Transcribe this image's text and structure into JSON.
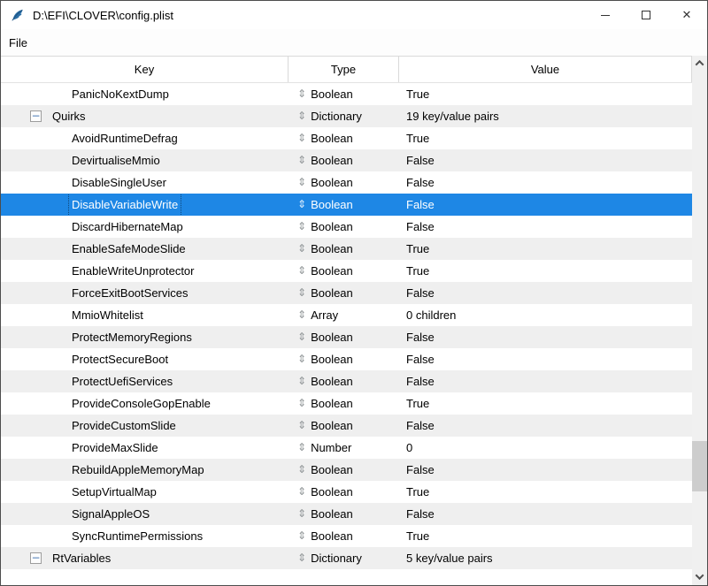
{
  "window": {
    "title": "D:\\EFI\\CLOVER\\config.plist"
  },
  "menu": {
    "items": [
      {
        "label": "File"
      }
    ]
  },
  "icons": {
    "app_icon": "python-feather-icon",
    "updown_glyph": "⇕",
    "collapse_glyph": "−",
    "close_glyph": "✕",
    "minimize_glyph": "–",
    "maximize_glyph": "□",
    "scroll_up": "chevron-up",
    "scroll_down": "chevron-down"
  },
  "colors": {
    "selection": "#1e87e5",
    "stripe": "#efefef",
    "scroll_track": "#f0f0f0",
    "scroll_thumb": "#cdcdcd"
  },
  "table": {
    "columns": [
      "Key",
      "Type",
      "Value"
    ],
    "rows": [
      {
        "key": "PanicNoKextDump",
        "type": "Boolean",
        "value": "True",
        "level": 2,
        "has_children": false,
        "selected": false
      },
      {
        "key": "Quirks",
        "type": "Dictionary",
        "value": "19 key/value pairs",
        "level": 1,
        "has_children": true,
        "selected": false
      },
      {
        "key": "AvoidRuntimeDefrag",
        "type": "Boolean",
        "value": "True",
        "level": 2,
        "has_children": false,
        "selected": false
      },
      {
        "key": "DevirtualiseMmio",
        "type": "Boolean",
        "value": "False",
        "level": 2,
        "has_children": false,
        "selected": false
      },
      {
        "key": "DisableSingleUser",
        "type": "Boolean",
        "value": "False",
        "level": 2,
        "has_children": false,
        "selected": false
      },
      {
        "key": "DisableVariableWrite",
        "type": "Boolean",
        "value": "False",
        "level": 2,
        "has_children": false,
        "selected": true
      },
      {
        "key": "DiscardHibernateMap",
        "type": "Boolean",
        "value": "False",
        "level": 2,
        "has_children": false,
        "selected": false
      },
      {
        "key": "EnableSafeModeSlide",
        "type": "Boolean",
        "value": "True",
        "level": 2,
        "has_children": false,
        "selected": false
      },
      {
        "key": "EnableWriteUnprotector",
        "type": "Boolean",
        "value": "True",
        "level": 2,
        "has_children": false,
        "selected": false
      },
      {
        "key": "ForceExitBootServices",
        "type": "Boolean",
        "value": "False",
        "level": 2,
        "has_children": false,
        "selected": false
      },
      {
        "key": "MmioWhitelist",
        "type": "Array",
        "value": "0 children",
        "level": 2,
        "has_children": false,
        "selected": false
      },
      {
        "key": "ProtectMemoryRegions",
        "type": "Boolean",
        "value": "False",
        "level": 2,
        "has_children": false,
        "selected": false
      },
      {
        "key": "ProtectSecureBoot",
        "type": "Boolean",
        "value": "False",
        "level": 2,
        "has_children": false,
        "selected": false
      },
      {
        "key": "ProtectUefiServices",
        "type": "Boolean",
        "value": "False",
        "level": 2,
        "has_children": false,
        "selected": false
      },
      {
        "key": "ProvideConsoleGopEnable",
        "type": "Boolean",
        "value": "True",
        "level": 2,
        "has_children": false,
        "selected": false
      },
      {
        "key": "ProvideCustomSlide",
        "type": "Boolean",
        "value": "False",
        "level": 2,
        "has_children": false,
        "selected": false
      },
      {
        "key": "ProvideMaxSlide",
        "type": "Number",
        "value": "0",
        "level": 2,
        "has_children": false,
        "selected": false
      },
      {
        "key": "RebuildAppleMemoryMap",
        "type": "Boolean",
        "value": "False",
        "level": 2,
        "has_children": false,
        "selected": false
      },
      {
        "key": "SetupVirtualMap",
        "type": "Boolean",
        "value": "True",
        "level": 2,
        "has_children": false,
        "selected": false
      },
      {
        "key": "SignalAppleOS",
        "type": "Boolean",
        "value": "False",
        "level": 2,
        "has_children": false,
        "selected": false
      },
      {
        "key": "SyncRuntimePermissions",
        "type": "Boolean",
        "value": "True",
        "level": 2,
        "has_children": false,
        "selected": false
      },
      {
        "key": "RtVariables",
        "type": "Dictionary",
        "value": "5 key/value pairs",
        "level": 1,
        "has_children": true,
        "selected": false
      }
    ]
  }
}
